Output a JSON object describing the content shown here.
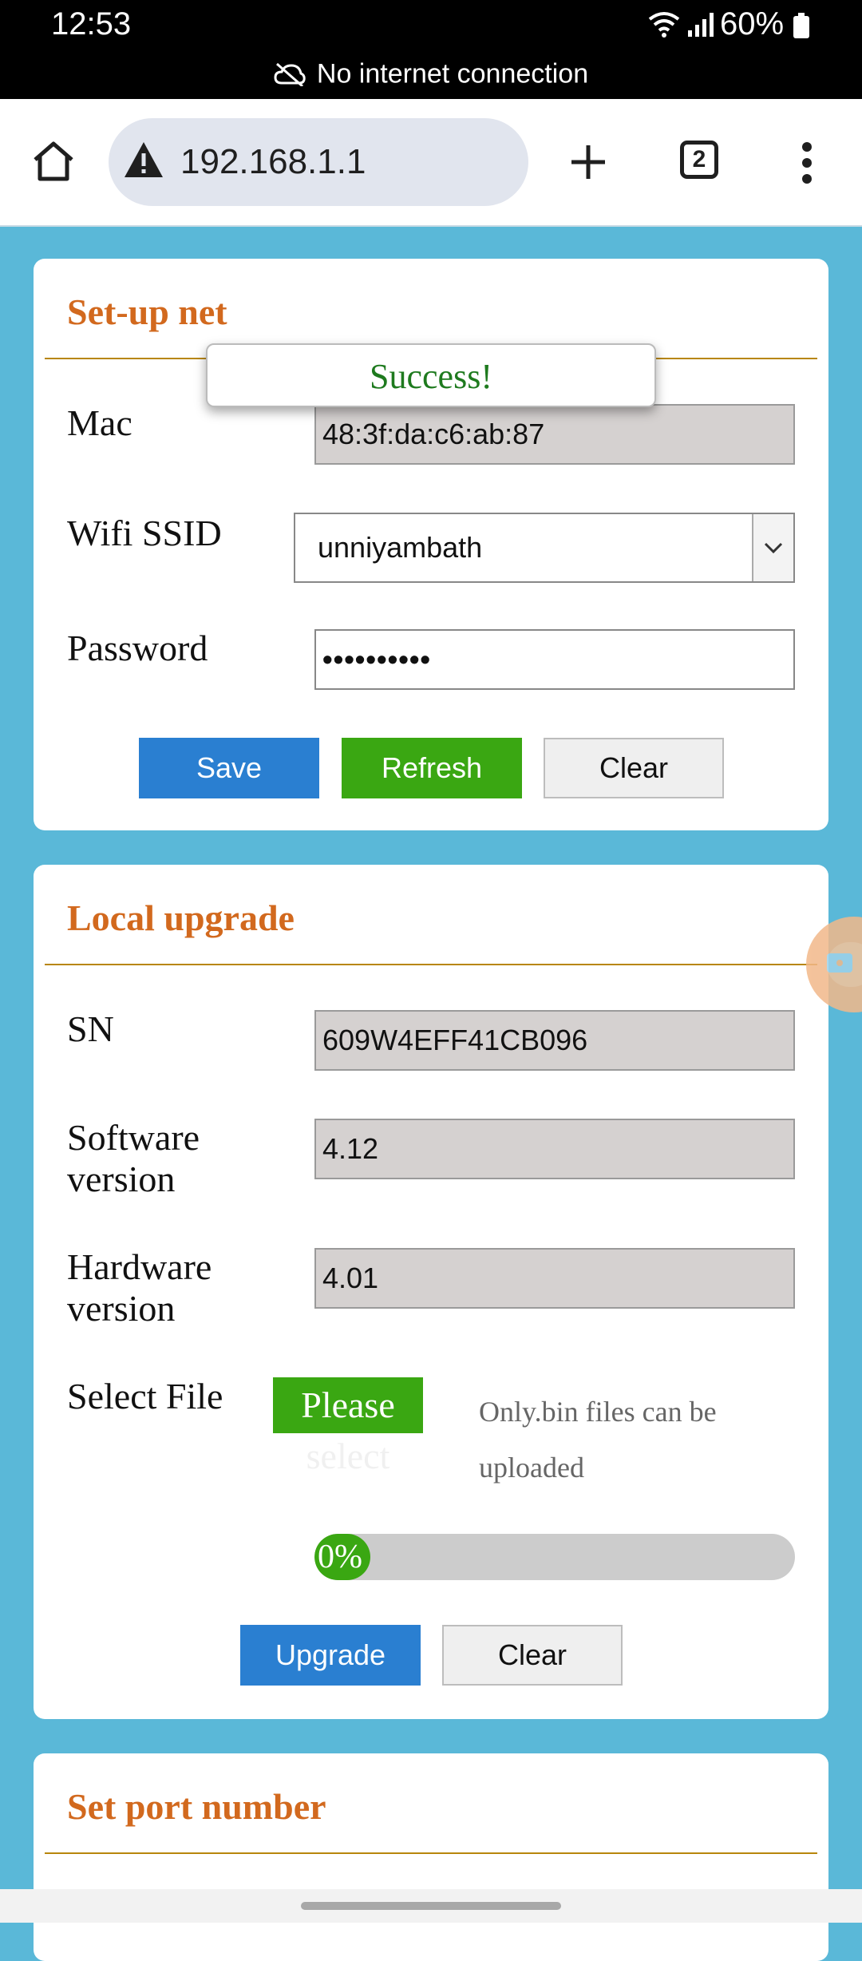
{
  "status_bar": {
    "time": "12:53",
    "battery": "60%",
    "network_notice": "No internet connection"
  },
  "browser": {
    "url": "192.168.1.1",
    "tab_count": "2",
    "icons": [
      "home-icon",
      "warning-icon",
      "new-tab-icon",
      "tab-switcher-icon",
      "more-menu-icon"
    ]
  },
  "setup_net": {
    "title": "Set-up net",
    "toast": "Success!",
    "mac_label": "Mac",
    "mac_value": "48:3f:da:c6:ab:87",
    "ssid_label": "Wifi SSID",
    "ssid_value": "unniyambath",
    "password_label": "Password",
    "password_value": "••••••••••",
    "save_label": "Save",
    "refresh_label": "Refresh",
    "clear_label": "Clear"
  },
  "local_upgrade": {
    "title": "Local upgrade",
    "sn_label": "SN",
    "sn_value": "609W4EFF41CB096",
    "software_label_1": "Software",
    "software_label_2": "version",
    "software_value": "4.12",
    "hardware_label_1": "Hardware",
    "hardware_label_2": "version",
    "hardware_value": "4.01",
    "file_label": "Select File",
    "file_button_1": "Please",
    "file_button_2": "select",
    "file_hint_1": "Only.bin files can be",
    "file_hint_2": "uploaded",
    "progress_text": "0%",
    "progress_value": 0,
    "upgrade_label": "Upgrade",
    "clear_label": "Clear"
  },
  "set_port": {
    "title": "Set port number"
  },
  "colors": {
    "page_bg": "#5ab8d8",
    "title": "#d2691e",
    "blue_button": "#2a7fd1",
    "green_button": "#3aa712"
  }
}
